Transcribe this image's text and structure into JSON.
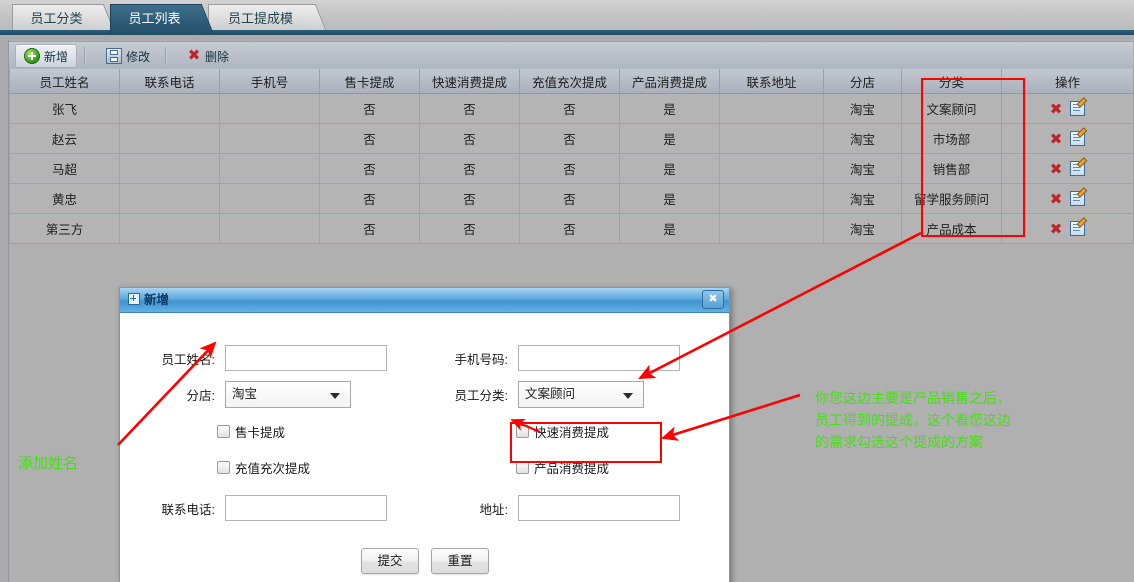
{
  "tabs": [
    {
      "label": "员工分类",
      "active": false
    },
    {
      "label": "员工列表",
      "active": true
    },
    {
      "label": "员工提成模版",
      "active": false
    }
  ],
  "toolbar": {
    "add_label": "新增",
    "edit_label": "修改",
    "delete_label": "删除",
    "add_icon": "add-circle-green-icon",
    "edit_icon": "floppy-save-icon",
    "delete_icon": "red-x-icon"
  },
  "table": {
    "columns": [
      "员工姓名",
      "联系电话",
      "手机号",
      "售卡提成",
      "快速消费提成",
      "充值充次提成",
      "产品消费提成",
      "联系地址",
      "分店",
      "分类",
      "操作"
    ],
    "rows": [
      {
        "name": "张飞",
        "phone": "",
        "mobile": "",
        "card": "否",
        "fast": "否",
        "recharge": "否",
        "product": "是",
        "address": "",
        "store": "淘宝",
        "category": "文案顾问"
      },
      {
        "name": "赵云",
        "phone": "",
        "mobile": "",
        "card": "否",
        "fast": "否",
        "recharge": "否",
        "product": "是",
        "address": "",
        "store": "淘宝",
        "category": "市场部"
      },
      {
        "name": "马超",
        "phone": "",
        "mobile": "",
        "card": "否",
        "fast": "否",
        "recharge": "否",
        "product": "是",
        "address": "",
        "store": "淘宝",
        "category": "销售部"
      },
      {
        "name": "黄忠",
        "phone": "",
        "mobile": "",
        "card": "否",
        "fast": "否",
        "recharge": "否",
        "product": "是",
        "address": "",
        "store": "淘宝",
        "category": "留学服务顾问"
      },
      {
        "name": "第三方",
        "phone": "",
        "mobile": "",
        "card": "否",
        "fast": "否",
        "recharge": "否",
        "product": "是",
        "address": "",
        "store": "淘宝",
        "category": "产品成本"
      }
    ],
    "op_delete_icon": "red-x-icon",
    "op_edit_icon": "pencil-edit-icon"
  },
  "dialog": {
    "title": "新增",
    "close_icon": "close-icon",
    "fields": {
      "name_label": "员工姓名:",
      "name_value": "",
      "mobile_label": "手机号码:",
      "mobile_value": "",
      "store_label": "分店:",
      "store_value": "淘宝",
      "category_label": "员工分类:",
      "category_value": "文案顾问",
      "phone_label": "联系电话:",
      "phone_value": "",
      "address_label": "地址:",
      "address_value": ""
    },
    "checkboxes": [
      {
        "label": "售卡提成",
        "checked": false
      },
      {
        "label": "快速消费提成",
        "checked": false
      },
      {
        "label": "充值充次提成",
        "checked": false
      },
      {
        "label": "产品消费提成",
        "checked": false
      }
    ],
    "submit_label": "提交",
    "reset_label": "重置"
  },
  "annotations": {
    "accent_red": "#ff0000",
    "accent_green": "#45e012",
    "note_left": "添加姓名",
    "note_right_line1": "你您这边主要是产品销售之后，",
    "note_right_line2": "员工得到的提成，这个看您这边",
    "note_right_line3": "的需求勾选这个提成的方案"
  }
}
